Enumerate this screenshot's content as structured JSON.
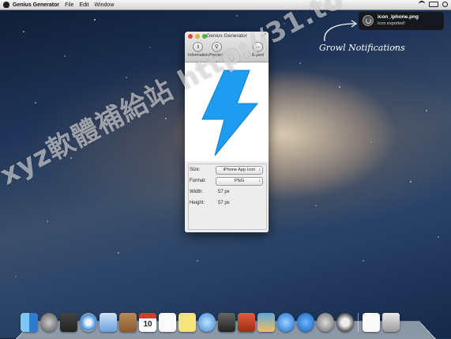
{
  "menubar": {
    "app_name": "Genius Generator",
    "items": [
      "File",
      "Edit",
      "Window"
    ]
  },
  "notification": {
    "title": "icon_iphone.png",
    "message": "Icon exported!",
    "caption": "Growl Notifications"
  },
  "window": {
    "title": "Genius Generator",
    "toolbar": [
      {
        "label": "Information",
        "icon": "info-icon",
        "glyph": "i"
      },
      {
        "label": "Preview",
        "icon": "magnifier-icon",
        "glyph": "⚲"
      },
      {
        "label": "Export",
        "icon": "export-arrow-icon",
        "glyph": "→"
      }
    ],
    "preview_icon": "lightning-bolt",
    "fields": {
      "size_label": "Size:",
      "size_value": "iPhone App Icon",
      "format_label": "Format:",
      "format_value": "PNG",
      "width_label": "Width:",
      "width_value": "57 px",
      "height_label": "Height:",
      "height_value": "57 px"
    }
  },
  "dock": {
    "items": [
      "Finder",
      "Launchpad",
      "Mission Control",
      "Safari",
      "Mail",
      "Contacts",
      "Calendar",
      "Reminders",
      "Notes",
      "Messages",
      "FaceTime",
      "Photo Booth",
      "iPhoto",
      "iTunes",
      "App Store",
      "System Preferences",
      "Genius Generator",
      "Document",
      "Trash"
    ],
    "calendar_day": "10"
  },
  "watermark": "xyz軟體補給站 http://31.to",
  "colors": {
    "bolt": "#1e9df0",
    "growl_bg": "#141416"
  }
}
